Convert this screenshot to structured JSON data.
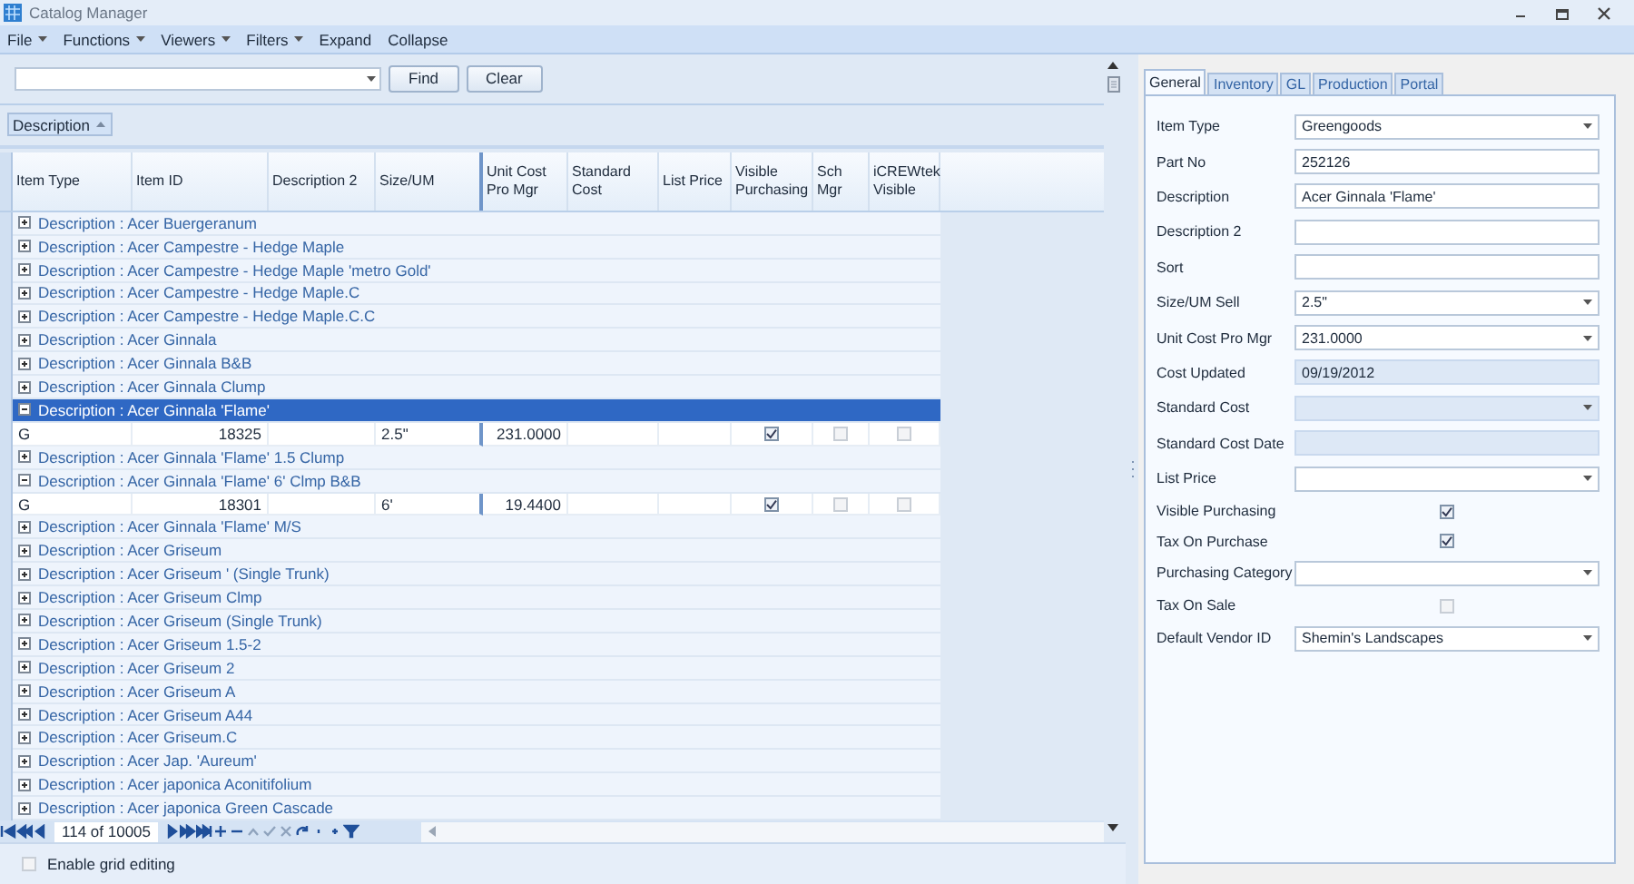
{
  "window": {
    "title": "Catalog Manager"
  },
  "menu": [
    {
      "label": "File",
      "dropdown": true
    },
    {
      "label": "Functions",
      "dropdown": true
    },
    {
      "label": "Viewers",
      "dropdown": true
    },
    {
      "label": "Filters",
      "dropdown": true
    },
    {
      "label": "Expand",
      "dropdown": false
    },
    {
      "label": "Collapse",
      "dropdown": false
    }
  ],
  "search": {
    "buttons": [
      "Find",
      "Clear"
    ]
  },
  "group_panel": {
    "label": "Description"
  },
  "table": {
    "columns": [
      "Item Type",
      "Item ID",
      "Description 2",
      "Size/UM",
      "Unit Cost Pro Mgr",
      "Standard Cost",
      "List Price",
      "Visible Purchasing",
      "Sch Mgr",
      "iCREWtek Visible"
    ],
    "rows": [
      {
        "kind": "group",
        "label": "Description : Acer Buergeranum",
        "expanded": false,
        "selected": false
      },
      {
        "kind": "group",
        "label": "Description : Acer Campestre - Hedge Maple",
        "expanded": false,
        "selected": false
      },
      {
        "kind": "group",
        "label": "Description : Acer Campestre - Hedge Maple 'metro Gold'",
        "expanded": false,
        "selected": false
      },
      {
        "kind": "group",
        "label": "Description : Acer Campestre - Hedge Maple.C",
        "expanded": false,
        "selected": false
      },
      {
        "kind": "group",
        "label": "Description : Acer Campestre - Hedge Maple.C.C",
        "expanded": false,
        "selected": false
      },
      {
        "kind": "group",
        "label": "Description : Acer Ginnala",
        "expanded": false,
        "selected": false
      },
      {
        "kind": "group",
        "label": "Description : Acer Ginnala  B&B",
        "expanded": false,
        "selected": false
      },
      {
        "kind": "group",
        "label": "Description : Acer Ginnala  Clump",
        "expanded": false,
        "selected": false
      },
      {
        "kind": "group",
        "label": "Description : Acer Ginnala 'Flame'",
        "expanded": true,
        "selected": true
      },
      {
        "kind": "item",
        "item_type": "G",
        "item_id": "18325",
        "size_um": "2.5\"",
        "unit_cost": "231.0000",
        "visible_purchasing": true,
        "sch_mgr": false,
        "icrewtek_visible": false
      },
      {
        "kind": "group",
        "label": "Description : Acer Ginnala 'Flame' 1.5 Clump",
        "expanded": false,
        "selected": false
      },
      {
        "kind": "group",
        "label": "Description : Acer Ginnala 'Flame' 6' Clmp B&B",
        "expanded": true,
        "selected": false
      },
      {
        "kind": "item",
        "item_type": "G",
        "item_id": "18301",
        "size_um": "6'",
        "unit_cost": "19.4400",
        "visible_purchasing": true,
        "sch_mgr": false,
        "icrewtek_visible": false
      },
      {
        "kind": "group",
        "label": "Description : Acer Ginnala 'Flame' M/S",
        "expanded": false,
        "selected": false
      },
      {
        "kind": "group",
        "label": "Description : Acer Griseum",
        "expanded": false,
        "selected": false
      },
      {
        "kind": "group",
        "label": "Description : Acer Griseum ' (Single Trunk)",
        "expanded": false,
        "selected": false
      },
      {
        "kind": "group",
        "label": "Description : Acer Griseum  Clmp",
        "expanded": false,
        "selected": false
      },
      {
        "kind": "group",
        "label": "Description : Acer Griseum (Single Trunk)",
        "expanded": false,
        "selected": false
      },
      {
        "kind": "group",
        "label": "Description : Acer Griseum 1.5-2",
        "expanded": false,
        "selected": false
      },
      {
        "kind": "group",
        "label": "Description : Acer Griseum 2",
        "expanded": false,
        "selected": false
      },
      {
        "kind": "group",
        "label": "Description : Acer Griseum A",
        "expanded": false,
        "selected": false
      },
      {
        "kind": "group",
        "label": "Description : Acer Griseum A44",
        "expanded": false,
        "selected": false
      },
      {
        "kind": "group",
        "label": "Description : Acer Griseum.C",
        "expanded": false,
        "selected": false
      },
      {
        "kind": "group",
        "label": "Description : Acer Jap. 'Aureum'",
        "expanded": false,
        "selected": false
      },
      {
        "kind": "group",
        "label": "Description : Acer japonica Aconitifolium",
        "expanded": false,
        "selected": false
      },
      {
        "kind": "group",
        "label": "Description : Acer japonica Green Cascade",
        "expanded": false,
        "selected": false
      }
    ]
  },
  "navigator": {
    "position": "114 of 10005"
  },
  "grid_editing": {
    "label": "Enable grid editing",
    "checked": false
  },
  "detail": {
    "tabs": [
      {
        "label": "General",
        "selected": true
      },
      {
        "label": "Inventory",
        "selected": false
      },
      {
        "label": "GL",
        "selected": false
      },
      {
        "label": "Production",
        "selected": false
      },
      {
        "label": "Portal",
        "selected": false
      }
    ],
    "fields": [
      {
        "kind": "dropdown",
        "label": "Item Type",
        "value": "Greengoods",
        "disabled": false
      },
      {
        "kind": "text",
        "label": "Part No",
        "value": "252126",
        "disabled": false
      },
      {
        "kind": "text",
        "label": "Description",
        "value": "Acer Ginnala 'Flame'",
        "disabled": false
      },
      {
        "kind": "text",
        "label": "Description 2",
        "disabled": false
      },
      {
        "kind": "text",
        "label": "Sort",
        "disabled": false
      },
      {
        "kind": "dropdown",
        "label": "Size/UM Sell",
        "value": "2.5\"",
        "disabled": false
      },
      {
        "kind": "dropdown",
        "label": "Unit Cost Pro Mgr",
        "value": "231.0000",
        "disabled": false
      },
      {
        "kind": "text",
        "label": "Cost Updated",
        "value": "09/19/2012",
        "disabled": true
      },
      {
        "kind": "dropdown",
        "label": "Standard Cost",
        "disabled": true
      },
      {
        "kind": "text",
        "label": "Standard Cost Date",
        "disabled": true
      },
      {
        "kind": "dropdown",
        "label": "List Price",
        "disabled": false
      },
      {
        "kind": "checkbox",
        "label": "Visible Purchasing",
        "checked": true
      },
      {
        "kind": "checkbox",
        "label": "Tax On Purchase",
        "checked": true
      },
      {
        "kind": "dropdown",
        "label": "Purchasing Category",
        "disabled": false
      },
      {
        "kind": "checkbox",
        "label": "Tax On Sale",
        "checked": false
      },
      {
        "kind": "dropdown",
        "label": "Default Vendor ID",
        "value": "Shemin's Landscapes",
        "disabled": false
      }
    ]
  }
}
